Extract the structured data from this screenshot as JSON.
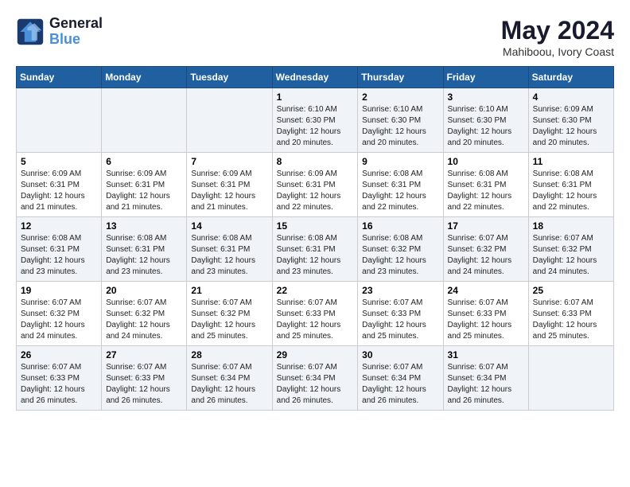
{
  "logo": {
    "line1": "General",
    "line2": "Blue"
  },
  "title": "May 2024",
  "subtitle": "Mahiboou, Ivory Coast",
  "days_header": [
    "Sunday",
    "Monday",
    "Tuesday",
    "Wednesday",
    "Thursday",
    "Friday",
    "Saturday"
  ],
  "weeks": [
    [
      {
        "num": "",
        "info": ""
      },
      {
        "num": "",
        "info": ""
      },
      {
        "num": "",
        "info": ""
      },
      {
        "num": "1",
        "info": "Sunrise: 6:10 AM\nSunset: 6:30 PM\nDaylight: 12 hours\nand 20 minutes."
      },
      {
        "num": "2",
        "info": "Sunrise: 6:10 AM\nSunset: 6:30 PM\nDaylight: 12 hours\nand 20 minutes."
      },
      {
        "num": "3",
        "info": "Sunrise: 6:10 AM\nSunset: 6:30 PM\nDaylight: 12 hours\nand 20 minutes."
      },
      {
        "num": "4",
        "info": "Sunrise: 6:09 AM\nSunset: 6:30 PM\nDaylight: 12 hours\nand 20 minutes."
      }
    ],
    [
      {
        "num": "5",
        "info": "Sunrise: 6:09 AM\nSunset: 6:31 PM\nDaylight: 12 hours\nand 21 minutes."
      },
      {
        "num": "6",
        "info": "Sunrise: 6:09 AM\nSunset: 6:31 PM\nDaylight: 12 hours\nand 21 minutes."
      },
      {
        "num": "7",
        "info": "Sunrise: 6:09 AM\nSunset: 6:31 PM\nDaylight: 12 hours\nand 21 minutes."
      },
      {
        "num": "8",
        "info": "Sunrise: 6:09 AM\nSunset: 6:31 PM\nDaylight: 12 hours\nand 22 minutes."
      },
      {
        "num": "9",
        "info": "Sunrise: 6:08 AM\nSunset: 6:31 PM\nDaylight: 12 hours\nand 22 minutes."
      },
      {
        "num": "10",
        "info": "Sunrise: 6:08 AM\nSunset: 6:31 PM\nDaylight: 12 hours\nand 22 minutes."
      },
      {
        "num": "11",
        "info": "Sunrise: 6:08 AM\nSunset: 6:31 PM\nDaylight: 12 hours\nand 22 minutes."
      }
    ],
    [
      {
        "num": "12",
        "info": "Sunrise: 6:08 AM\nSunset: 6:31 PM\nDaylight: 12 hours\nand 23 minutes."
      },
      {
        "num": "13",
        "info": "Sunrise: 6:08 AM\nSunset: 6:31 PM\nDaylight: 12 hours\nand 23 minutes."
      },
      {
        "num": "14",
        "info": "Sunrise: 6:08 AM\nSunset: 6:31 PM\nDaylight: 12 hours\nand 23 minutes."
      },
      {
        "num": "15",
        "info": "Sunrise: 6:08 AM\nSunset: 6:31 PM\nDaylight: 12 hours\nand 23 minutes."
      },
      {
        "num": "16",
        "info": "Sunrise: 6:08 AM\nSunset: 6:32 PM\nDaylight: 12 hours\nand 23 minutes."
      },
      {
        "num": "17",
        "info": "Sunrise: 6:07 AM\nSunset: 6:32 PM\nDaylight: 12 hours\nand 24 minutes."
      },
      {
        "num": "18",
        "info": "Sunrise: 6:07 AM\nSunset: 6:32 PM\nDaylight: 12 hours\nand 24 minutes."
      }
    ],
    [
      {
        "num": "19",
        "info": "Sunrise: 6:07 AM\nSunset: 6:32 PM\nDaylight: 12 hours\nand 24 minutes."
      },
      {
        "num": "20",
        "info": "Sunrise: 6:07 AM\nSunset: 6:32 PM\nDaylight: 12 hours\nand 24 minutes."
      },
      {
        "num": "21",
        "info": "Sunrise: 6:07 AM\nSunset: 6:32 PM\nDaylight: 12 hours\nand 25 minutes."
      },
      {
        "num": "22",
        "info": "Sunrise: 6:07 AM\nSunset: 6:33 PM\nDaylight: 12 hours\nand 25 minutes."
      },
      {
        "num": "23",
        "info": "Sunrise: 6:07 AM\nSunset: 6:33 PM\nDaylight: 12 hours\nand 25 minutes."
      },
      {
        "num": "24",
        "info": "Sunrise: 6:07 AM\nSunset: 6:33 PM\nDaylight: 12 hours\nand 25 minutes."
      },
      {
        "num": "25",
        "info": "Sunrise: 6:07 AM\nSunset: 6:33 PM\nDaylight: 12 hours\nand 25 minutes."
      }
    ],
    [
      {
        "num": "26",
        "info": "Sunrise: 6:07 AM\nSunset: 6:33 PM\nDaylight: 12 hours\nand 26 minutes."
      },
      {
        "num": "27",
        "info": "Sunrise: 6:07 AM\nSunset: 6:33 PM\nDaylight: 12 hours\nand 26 minutes."
      },
      {
        "num": "28",
        "info": "Sunrise: 6:07 AM\nSunset: 6:34 PM\nDaylight: 12 hours\nand 26 minutes."
      },
      {
        "num": "29",
        "info": "Sunrise: 6:07 AM\nSunset: 6:34 PM\nDaylight: 12 hours\nand 26 minutes."
      },
      {
        "num": "30",
        "info": "Sunrise: 6:07 AM\nSunset: 6:34 PM\nDaylight: 12 hours\nand 26 minutes."
      },
      {
        "num": "31",
        "info": "Sunrise: 6:07 AM\nSunset: 6:34 PM\nDaylight: 12 hours\nand 26 minutes."
      },
      {
        "num": "",
        "info": ""
      }
    ]
  ]
}
